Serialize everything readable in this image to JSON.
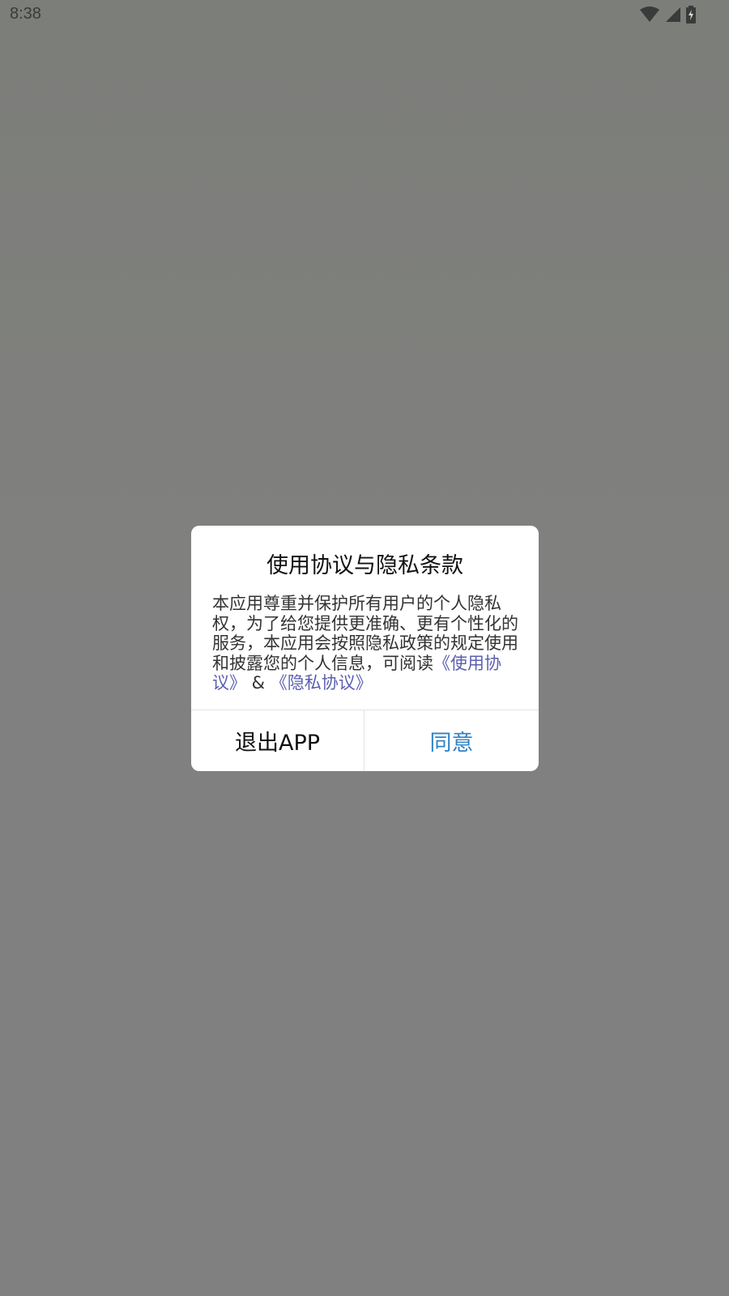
{
  "status_bar": {
    "time": "8:38",
    "icons": [
      "wifi-icon",
      "cell-signal-icon",
      "battery-charging-icon"
    ]
  },
  "dialog": {
    "title": "使用协议与隐私条款",
    "body_text": "本应用尊重并保护所有用户的个人隐私权，为了给您提供更准确、更有个性化的服务，本应用会按照隐私政策的规定使用和披露您的个人信息，可阅读",
    "link_usage": "《使用协议》",
    "separator": " & ",
    "link_privacy": "《隐私协议》",
    "exit_button": "退出APP",
    "agree_button": "同意"
  },
  "colors": {
    "overlay": "#808080",
    "link": "#5a5fb0",
    "agree": "#2f82c4"
  }
}
